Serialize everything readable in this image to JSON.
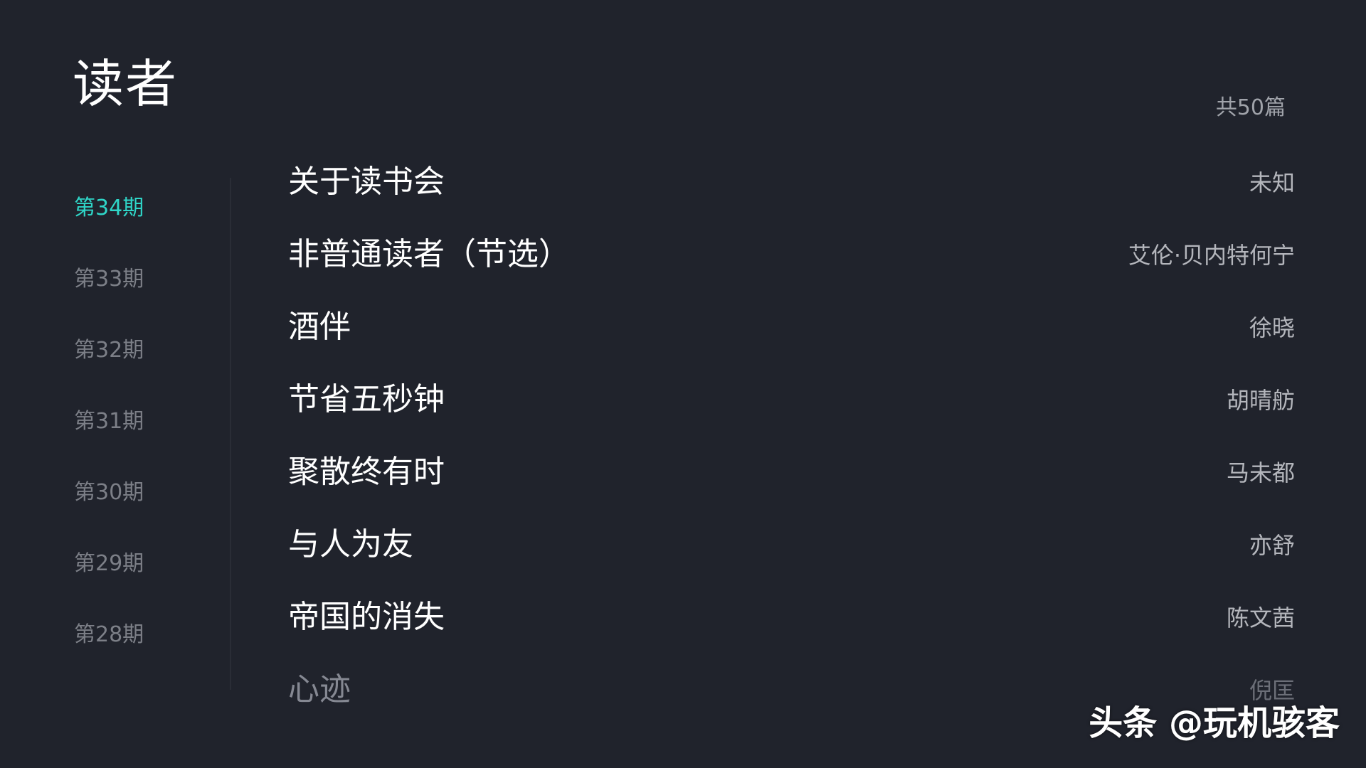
{
  "header": {
    "title": "读者",
    "article_count": "共50篇"
  },
  "issues": [
    {
      "label": "第34期",
      "selected": true
    },
    {
      "label": "第33期",
      "selected": false
    },
    {
      "label": "第32期",
      "selected": false
    },
    {
      "label": "第31期",
      "selected": false
    },
    {
      "label": "第30期",
      "selected": false
    },
    {
      "label": "第29期",
      "selected": false
    },
    {
      "label": "第28期",
      "selected": false
    }
  ],
  "articles": [
    {
      "title": "关于读书会",
      "author": "未知"
    },
    {
      "title": "非普通读者（节选）",
      "author": "艾伦·贝内特何宁"
    },
    {
      "title": "酒伴",
      "author": "徐晓"
    },
    {
      "title": "节省五秒钟",
      "author": "胡晴舫"
    },
    {
      "title": "聚散终有时",
      "author": "马未都"
    },
    {
      "title": "与人为友",
      "author": "亦舒"
    },
    {
      "title": "帝国的消失",
      "author": "陈文茜"
    },
    {
      "title": "心迹",
      "author": "倪匡"
    }
  ],
  "watermark": "头条 @玩机骇客",
  "colors": {
    "background": "#20232c",
    "accent": "#2fd6c8",
    "inactive_issue": "#7c7f87"
  }
}
